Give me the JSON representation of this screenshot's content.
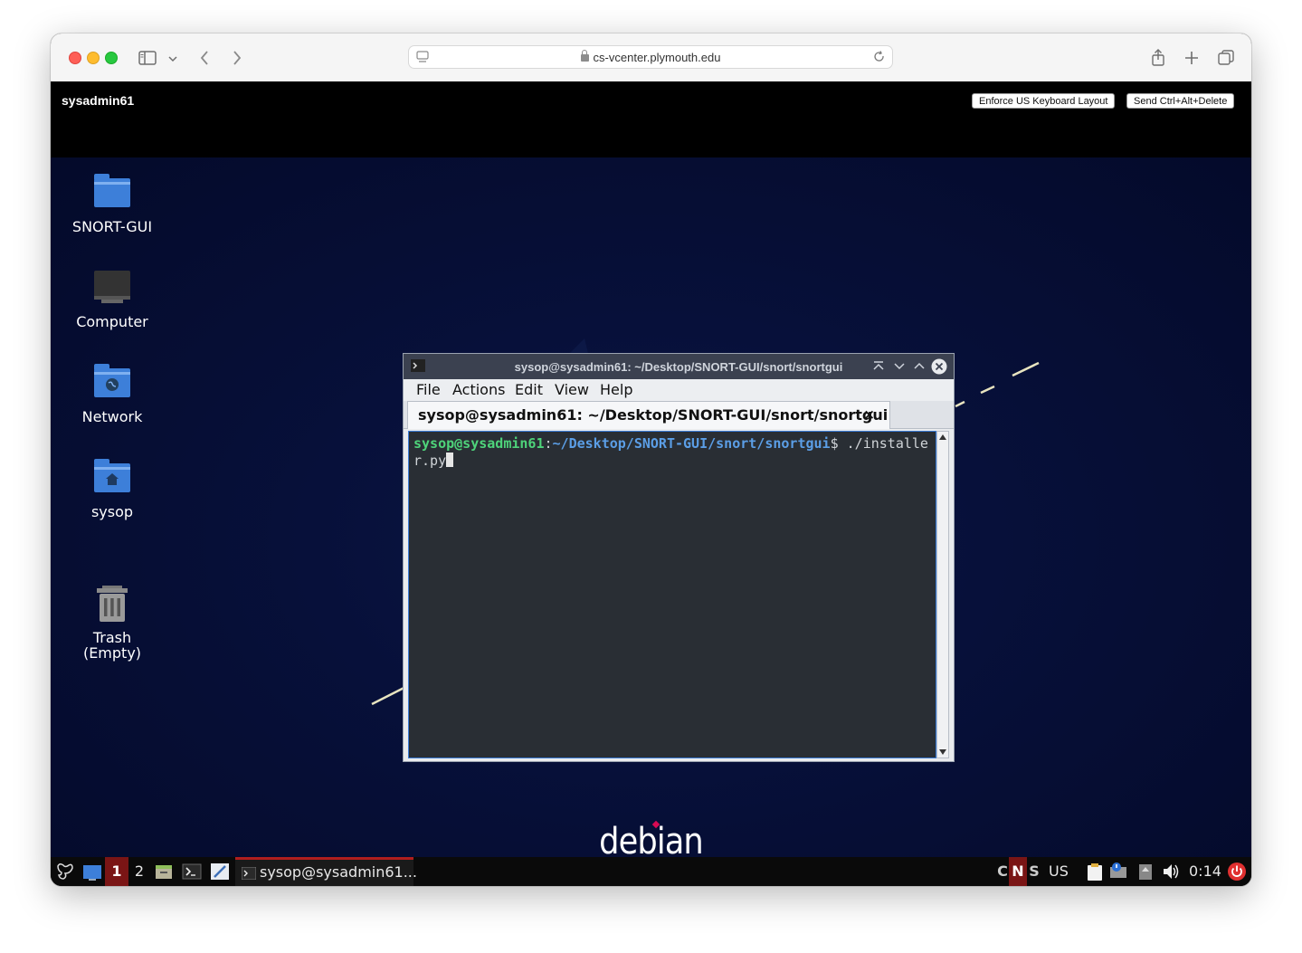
{
  "browser": {
    "url": "cs-vcenter.plymouth.edu"
  },
  "console": {
    "vm_name": "sysadmin61",
    "enforce_keyboard_label": "Enforce US Keyboard Layout",
    "send_cad_label": "Send Ctrl+Alt+Delete"
  },
  "desktop": {
    "icons": [
      {
        "label": "SNORT-GUI",
        "icon": "folder-icon"
      },
      {
        "label": "Computer",
        "icon": "computer-icon"
      },
      {
        "label": "Network",
        "icon": "network-folder-icon"
      },
      {
        "label": "sysop",
        "icon": "home-folder-icon"
      },
      {
        "label": "Trash\n(Empty)",
        "icon": "trash-icon"
      }
    ],
    "wallpaper_text": "debian"
  },
  "terminal": {
    "title": "sysop@sysadmin61: ~/Desktop/SNORT-GUI/snort/snortgui",
    "menu": [
      "File",
      "Actions",
      "Edit",
      "View",
      "Help"
    ],
    "tab_label": "sysop@sysadmin61: ~/Desktop/SNORT-GUI/snort/snortgui",
    "prompt_user": "sysop@sysadmin61",
    "prompt_sep": ":",
    "prompt_path": "~/Desktop/SNORT-GUI/snort/snortgui",
    "command": "$ ./installer.py"
  },
  "taskbar": {
    "workspace_1": "1",
    "workspace_2": "2",
    "task_label": "sysop@sysadmin61...",
    "indicator_c": "C",
    "indicator_n": "N",
    "indicator_s": "S",
    "keyboard_layout": "US",
    "clock": "0:14"
  },
  "colors": {
    "prompt_user": "#4ed37a",
    "prompt_path": "#5b9ee6",
    "terminal_bg": "#292e34",
    "active_workspace": "#8b1a1a",
    "power": "#e03030"
  }
}
